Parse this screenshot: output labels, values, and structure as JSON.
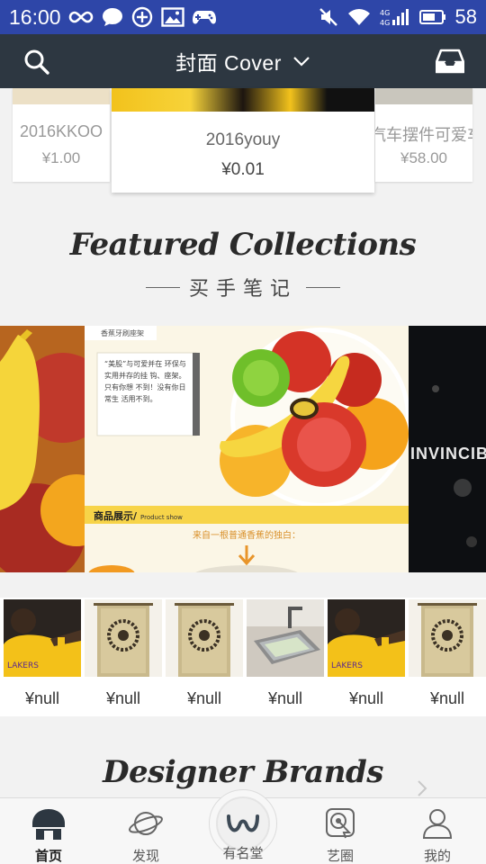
{
  "status_bar": {
    "time": "16:00",
    "battery": "58",
    "icons": [
      "infinity-icon",
      "chat-bubble-icon",
      "circle-plus-icon",
      "image-icon",
      "gamepad-icon",
      "mute-icon",
      "wifi-icon",
      "4g-signal-icon",
      "battery-icon"
    ]
  },
  "header": {
    "title": "封面 Cover",
    "search_icon": "search-icon",
    "inbox_icon": "inbox-icon",
    "dropdown_icon": "chevron-down-icon"
  },
  "top_products": [
    {
      "name": "2016KKOO",
      "price": "¥1.00"
    },
    {
      "name": "2016youy",
      "price": "¥0.01"
    },
    {
      "name": "汽车摆件可爱车",
      "price": "¥58.00"
    }
  ],
  "featured": {
    "title": "Featured Collections",
    "subtitle": "买手笔记"
  },
  "banner": {
    "center_texts": [
      "香蕉牙刷座架",
      "“美股”与可爱并在 环保与实用并存的挂 钩、座架。只有你想 不到！没有你日常生 活用不到。",
      "商品展示/",
      "Product show",
      "来自一根普通香蕉的独白："
    ],
    "right_text": "INVINCIBL"
  },
  "thumbnails": [
    {
      "price": "¥null",
      "image": "player-photo"
    },
    {
      "price": "¥null",
      "image": "curtain"
    },
    {
      "price": "¥null",
      "image": "curtain"
    },
    {
      "price": "¥null",
      "image": "sink"
    },
    {
      "price": "¥null",
      "image": "player-photo"
    },
    {
      "price": "¥null",
      "image": "curtain"
    }
  ],
  "brands": {
    "title": "Designer Brands"
  },
  "bottom_nav": [
    {
      "label": "首页",
      "icon": "home-icon",
      "active": true
    },
    {
      "label": "发现",
      "icon": "planet-icon",
      "active": false
    },
    {
      "label": "有名堂",
      "icon": "w-logo-icon",
      "active": false
    },
    {
      "label": "艺圈",
      "icon": "target-tap-icon",
      "active": false
    },
    {
      "label": "我的",
      "icon": "user-icon",
      "active": false
    }
  ],
  "colors": {
    "status_bar": "#2e46a8",
    "app_bar": "#2d3741",
    "background": "#f2f2f2"
  }
}
